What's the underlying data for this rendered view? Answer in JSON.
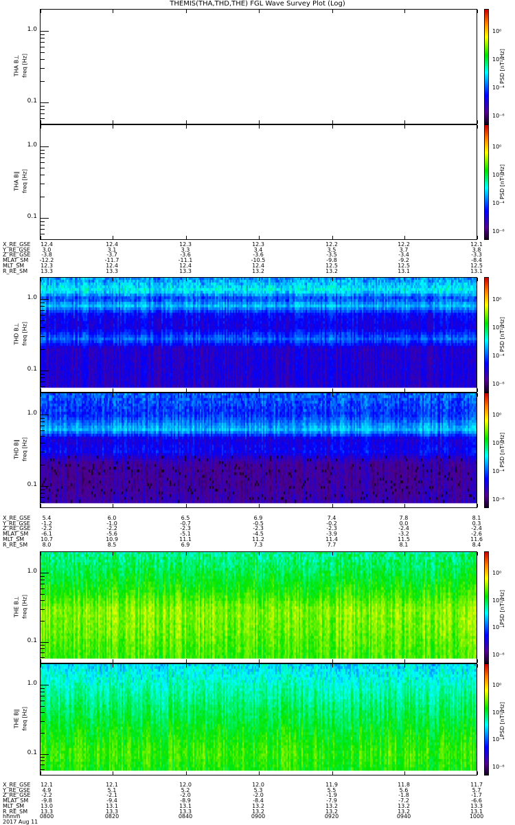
{
  "title": "THEMIS(THA,THD,THE) FGL Wave Survey Plot (Log)",
  "chart_data": {
    "type": "heatmap",
    "title": "THEMIS(THA,THD,THE) FGL Wave Survey Plot (Log)",
    "xlabel": "hhmm",
    "date_label": "2017 Aug 11",
    "x_ticks": [
      "0800",
      "0820",
      "0840",
      "0900",
      "0920",
      "0940",
      "1000"
    ],
    "ylabel": "freq [Hz]",
    "yscale": "log",
    "ylim": [
      0.05,
      2.0
    ],
    "y_ticks": [
      "1.0",
      "0.1"
    ],
    "colorbar": {
      "label": "PSD [nT²/Hz]",
      "scale": "log",
      "range_log10": [
        -6.6,
        1.6
      ],
      "ticks": [
        "10⁰",
        "10⁻²",
        "10⁻⁴",
        "10⁻⁶"
      ]
    },
    "panels": [
      {
        "probe": "THA",
        "label": "THA B⊥",
        "has_data": false,
        "psd_profile": []
      },
      {
        "probe": "THA",
        "label": "THA B∥",
        "has_data": false,
        "psd_profile": []
      },
      {
        "probe": "THD",
        "label": "THD B⊥",
        "has_data": true,
        "psd_profile": [
          [
            2.0,
            -3.7
          ],
          [
            1.3,
            -2.9
          ],
          [
            1.0,
            -4.2
          ],
          [
            0.8,
            -3.3
          ],
          [
            0.6,
            -4.6
          ],
          [
            0.4,
            -4.9
          ],
          [
            0.27,
            -3.9
          ],
          [
            0.2,
            -5.1
          ],
          [
            0.1,
            -5.0
          ],
          [
            0.06,
            -5.1
          ]
        ]
      },
      {
        "probe": "THD",
        "label": "THD B∥",
        "has_data": true,
        "psd_profile": [
          [
            2.0,
            -3.9
          ],
          [
            1.0,
            -4.3
          ],
          [
            0.6,
            -3.3
          ],
          [
            0.45,
            -4.9
          ],
          [
            0.3,
            -4.6
          ],
          [
            0.2,
            -5.6
          ],
          [
            0.1,
            -5.6
          ],
          [
            0.06,
            -5.4
          ]
        ]
      },
      {
        "probe": "THE",
        "label": "THE B⊥",
        "has_data": true,
        "psd_profile": [
          [
            2.0,
            -2.4
          ],
          [
            1.0,
            -2.0
          ],
          [
            0.5,
            -1.5
          ],
          [
            0.3,
            -1.0
          ],
          [
            0.15,
            -1.1
          ],
          [
            0.06,
            -1.4
          ]
        ]
      },
      {
        "probe": "THE",
        "label": "THE B∥",
        "has_data": true,
        "psd_profile": [
          [
            2.0,
            -3.1
          ],
          [
            1.0,
            -2.6
          ],
          [
            0.5,
            -2.2
          ],
          [
            0.2,
            -1.7
          ],
          [
            0.1,
            -1.4
          ],
          [
            0.06,
            -1.6
          ]
        ]
      }
    ]
  },
  "ephemeris": [
    {
      "probe": "THA",
      "rows": [
        {
          "label": "X_RE_GSE",
          "values": [
            "12.4",
            "12.4",
            "12.3",
            "12.3",
            "12.2",
            "12.2",
            "12.1"
          ]
        },
        {
          "label": "Y_RE_GSE",
          "values": [
            "3.0",
            "3.1",
            "3.3",
            "3.4",
            "3.5",
            "3.7",
            "3.8"
          ]
        },
        {
          "label": "Z_RE_GSE",
          "values": [
            "-3.8",
            "-3.7",
            "-3.6",
            "-3.6",
            "-3.5",
            "-3.4",
            "-3.3"
          ]
        },
        {
          "label": "MLAT_SM",
          "values": [
            "-12.2",
            "-11.7",
            "-11.1",
            "-10.5",
            "-9.8",
            "-9.2",
            "-8.4"
          ]
        },
        {
          "label": "MLT_SM",
          "values": [
            "12.3",
            "12.4",
            "12.4",
            "12.4",
            "12.5",
            "12.5",
            "12.5"
          ]
        },
        {
          "label": "R_RE_SM",
          "values": [
            "13.3",
            "13.3",
            "13.3",
            "13.2",
            "13.2",
            "13.1",
            "13.1"
          ]
        }
      ]
    },
    {
      "probe": "THD",
      "rows": [
        {
          "label": "X_RE_GSE",
          "values": [
            "5.4",
            "6.0",
            "6.5",
            "6.9",
            "7.4",
            "7.8",
            "8.1"
          ]
        },
        {
          "label": "Y_RE_GSE",
          "values": [
            "-1.2",
            "-1.0",
            "-0.7",
            "-0.5",
            "-0.2",
            "0.0",
            "0.3"
          ]
        },
        {
          "label": "Z_RE_GSE",
          "values": [
            "-2.2",
            "-2.2",
            "-2.3",
            "-2.3",
            "-2.3",
            "-2.4",
            "-2.4"
          ]
        },
        {
          "label": "MLAT_SM",
          "values": [
            "-6.1",
            "-5.6",
            "-5.1",
            "-4.5",
            "-3.9",
            "-3.2",
            "-2.6"
          ]
        },
        {
          "label": "MLT_SM",
          "values": [
            "10.7",
            "10.9",
            "11.1",
            "11.2",
            "11.4",
            "11.5",
            "11.6"
          ]
        },
        {
          "label": "R_RE_SM",
          "values": [
            "8.0",
            "8.5",
            "6.9",
            "7.3",
            "7.7",
            "8.1",
            "8.4"
          ]
        }
      ]
    },
    {
      "probe": "THE",
      "rows": [
        {
          "label": "X_RE_GSE",
          "values": [
            "12.1",
            "12.1",
            "12.0",
            "12.0",
            "11.9",
            "11.8",
            "11.7"
          ]
        },
        {
          "label": "Y_RE_GSE",
          "values": [
            "4.9",
            "5.1",
            "5.2",
            "5.3",
            "5.5",
            "5.6",
            "5.7"
          ]
        },
        {
          "label": "Z_RE_GSE",
          "values": [
            "-2.2",
            "-2.1",
            "-2.0",
            "-2.0",
            "-1.9",
            "-1.8",
            "-1.7"
          ]
        },
        {
          "label": "MLAT_SM",
          "values": [
            "-9.8",
            "-9.4",
            "-8.9",
            "-8.4",
            "-7.9",
            "-7.2",
            "-6.6"
          ]
        },
        {
          "label": "MLT_SM",
          "values": [
            "13.0",
            "13.1",
            "13.1",
            "13.2",
            "13.2",
            "13.2",
            "13.3"
          ]
        },
        {
          "label": "R_RE_SM",
          "values": [
            "13.3",
            "13.3",
            "13.3",
            "13.2",
            "13.2",
            "13.2",
            "13.1"
          ]
        },
        {
          "label": "hhmm",
          "values": [
            "0800",
            "0820",
            "0840",
            "0900",
            "0920",
            "0940",
            "1000"
          ]
        }
      ]
    }
  ]
}
